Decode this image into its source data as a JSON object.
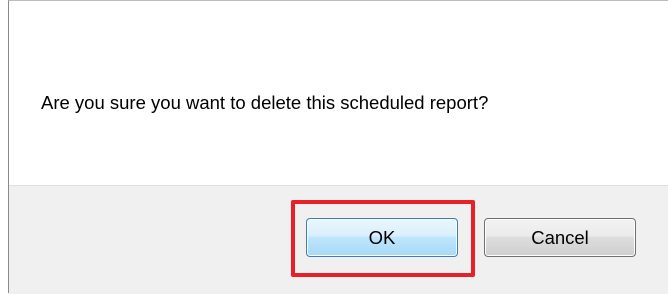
{
  "dialog": {
    "message": "Are you sure you want to delete this scheduled report?",
    "ok_label": "OK",
    "cancel_label": "Cancel"
  },
  "colors": {
    "highlight": "#e8202a",
    "ok_border": "#3c7fb1",
    "button_bar_bg": "#f0f0f0"
  }
}
